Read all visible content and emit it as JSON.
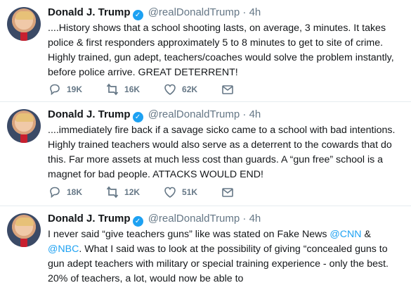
{
  "tweets": [
    {
      "name": "Donald J. Trump",
      "handle": "@realDonaldTrump",
      "separator": "·",
      "time": "4h",
      "text": "....History shows that a school shooting lasts, on average, 3 minutes. It takes police & first responders approximately 5 to 8 minutes to get to site of crime. Highly trained, gun adept, teachers/coaches would solve the problem instantly, before police arrive. GREAT DETERRENT!",
      "replies": "19K",
      "retweets": "16K",
      "likes": "62K"
    },
    {
      "name": "Donald J. Trump",
      "handle": "@realDonaldTrump",
      "separator": "·",
      "time": "4h",
      "text": "....immediately fire back if a savage sicko came to a school with bad intentions. Highly trained teachers would also serve as a deterrent to the cowards that do this. Far more assets at much less cost than guards. A “gun free” school is a magnet for bad people. ATTACKS WOULD END!",
      "replies": "18K",
      "retweets": "12K",
      "likes": "51K"
    },
    {
      "name": "Donald J. Trump",
      "handle": "@realDonaldTrump",
      "separator": "·",
      "time": "4h",
      "text_before": "I never said “give teachers guns” like was stated on Fake News ",
      "mention_1": "@CNN",
      "amp": " & ",
      "mention_2": "@NBC",
      "text_after": ". What I said was to look at the possibility of giving “concealed guns to gun adept teachers with military or special training experience - only the best. 20% of teachers, a lot, would now be able to"
    }
  ],
  "icons": {
    "verified": "verified-badge-icon",
    "reply": "reply-icon",
    "retweet": "retweet-icon",
    "like": "heart-icon",
    "message": "envelope-icon"
  },
  "colors": {
    "link": "#1da1f2",
    "muted": "#657786",
    "border": "#e6ecf0"
  }
}
